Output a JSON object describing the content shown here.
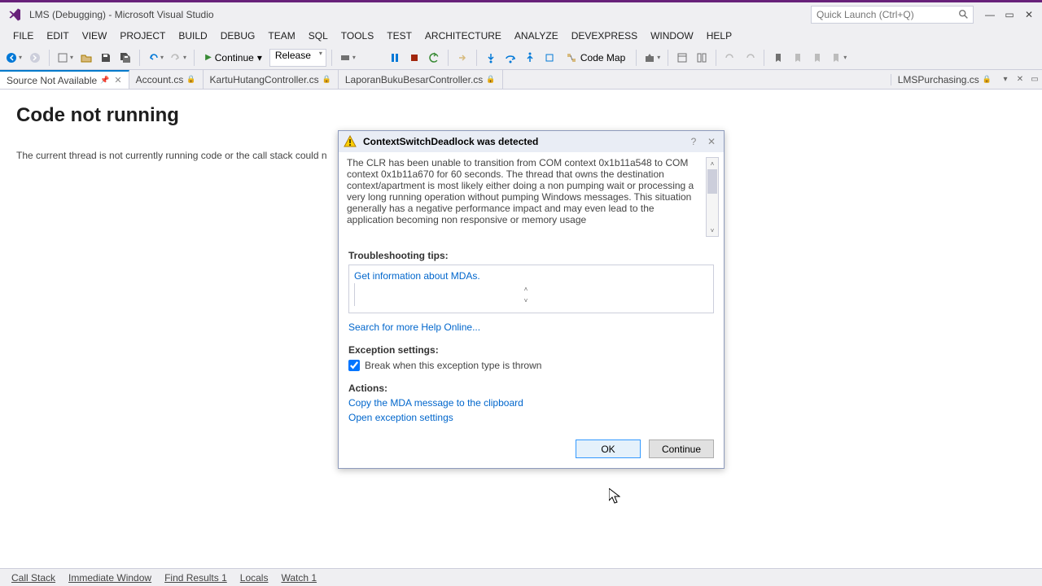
{
  "title": "LMS (Debugging) - Microsoft Visual Studio",
  "quick_launch": {
    "placeholder": "Quick Launch (Ctrl+Q)"
  },
  "menu": [
    "FILE",
    "EDIT",
    "VIEW",
    "PROJECT",
    "BUILD",
    "DEBUG",
    "TEAM",
    "SQL",
    "TOOLS",
    "TEST",
    "ARCHITECTURE",
    "ANALYZE",
    "DEVEXPRESS",
    "WINDOW",
    "HELP"
  ],
  "toolbar": {
    "continue": "Continue",
    "config": "Release",
    "codemap": "Code Map"
  },
  "tabs": {
    "items": [
      {
        "label": "Source Not Available",
        "active": true,
        "pinned": true,
        "closable": true
      },
      {
        "label": "Account.cs",
        "active": false,
        "lock": true
      },
      {
        "label": "KartuHutangController.cs",
        "active": false,
        "lock": true
      },
      {
        "label": "LaporanBukuBesarController.cs",
        "active": false,
        "lock": true
      }
    ],
    "right": {
      "label": "LMSPurchasing.cs",
      "lock": true
    }
  },
  "content": {
    "heading": "Code not running",
    "body": "The current thread is not currently running code or the call stack could n"
  },
  "dialog": {
    "title": "ContextSwitchDeadlock was detected",
    "message": "The CLR has been unable to transition from COM context 0x1b11a548 to COM context 0x1b11a670 for 60 seconds. The thread that owns the destination context/apartment is most likely either doing a non pumping wait or processing a very long running operation without pumping Windows messages. This situation generally has a negative performance impact and may even lead to the application becoming non responsive or memory usage",
    "tips_label": "Troubleshooting tips:",
    "tips_link": "Get information about MDAs.",
    "help_link": "Search for more Help Online...",
    "exc_label": "Exception settings:",
    "exc_check": "Break when this exception type is thrown",
    "actions_label": "Actions:",
    "action_copy": "Copy the MDA message to the clipboard",
    "action_open": "Open exception settings",
    "ok": "OK",
    "continue": "Continue"
  },
  "bottom_tabs": [
    "Call Stack",
    "Immediate Window",
    "Find Results 1",
    "Locals",
    "Watch 1"
  ]
}
